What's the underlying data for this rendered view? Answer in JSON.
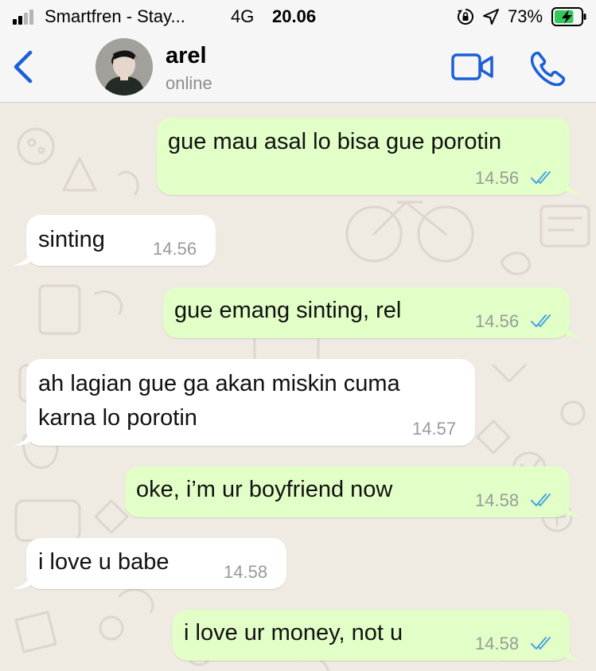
{
  "status_bar": {
    "carrier": "Smartfren - Stay...",
    "network": "4G",
    "time": "20.06",
    "battery": "73%",
    "battery_level": 0.73
  },
  "chat_header": {
    "contact_name": "arel",
    "contact_status": "online"
  },
  "messages": [
    {
      "direction": "outgoing",
      "text": "gue mau asal lo bisa gue porotin",
      "time": "14.56",
      "read": true
    },
    {
      "direction": "incoming",
      "text": "sinting",
      "time": "14.56"
    },
    {
      "direction": "outgoing",
      "text": "gue emang sinting, rel",
      "time": "14.56",
      "read": true
    },
    {
      "direction": "incoming",
      "text_line1": "ah lagian gue ga akan miskin cuma",
      "text_line2": "karna lo porotin",
      "time": "14.57"
    },
    {
      "direction": "outgoing",
      "text": "oke, i’m ur boyfriend now",
      "time": "14.58",
      "read": true
    },
    {
      "direction": "incoming",
      "text": "i love u babe",
      "time": "14.58"
    },
    {
      "direction": "outgoing",
      "text": "i love ur money, not u",
      "time": "14.58",
      "read": true
    }
  ],
  "colors": {
    "accent": "#1a5fd8",
    "outgoing_bubble": "#e2ffc7",
    "incoming_bubble": "#ffffff",
    "read_ticks": "#4aa3df",
    "wallpaper": "#efeae2"
  }
}
